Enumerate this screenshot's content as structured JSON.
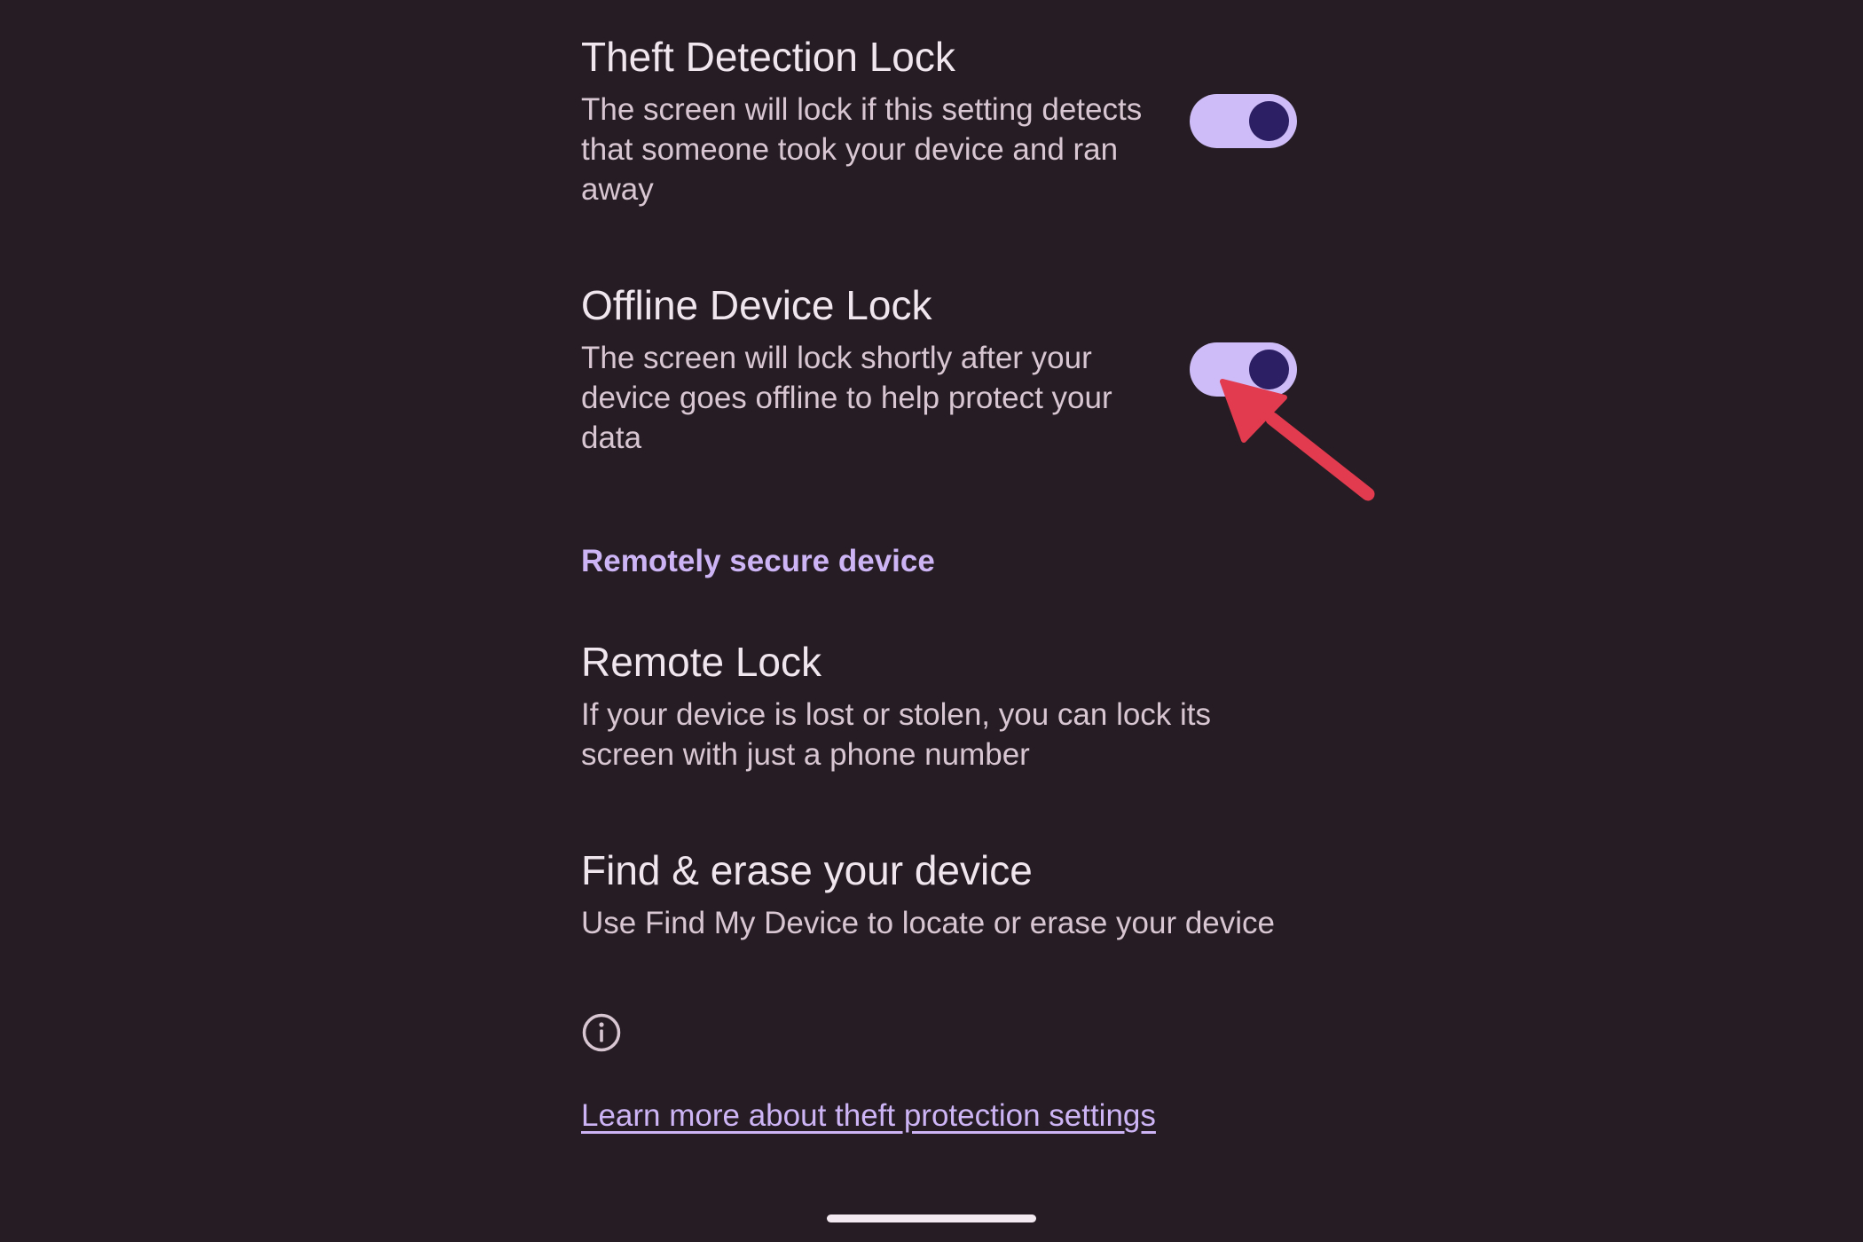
{
  "settings": {
    "theft_detection": {
      "title": "Theft Detection Lock",
      "description": "The screen will lock if this setting detects that someone took your device and ran away",
      "enabled": true
    },
    "offline_lock": {
      "title": "Offline Device Lock",
      "description": "The screen will lock shortly after your device goes offline to help protect your data",
      "enabled": true
    },
    "remote_section": {
      "header": "Remotely secure device"
    },
    "remote_lock": {
      "title": "Remote Lock",
      "description": "If your device is lost or stolen, you can lock its screen with just a phone number"
    },
    "find_erase": {
      "title": "Find & erase your device",
      "description": "Use Find My Device to locate or erase your device"
    },
    "info_icon": "info-circle-icon",
    "learn_more_link": "Learn more about theft protection settings"
  },
  "colors": {
    "background": "#251d23",
    "toggle_track": "#cdbcf7",
    "toggle_thumb": "#2c1f63",
    "accent_text": "#cdb4f5",
    "annotation_arrow": "#e23a4e"
  }
}
